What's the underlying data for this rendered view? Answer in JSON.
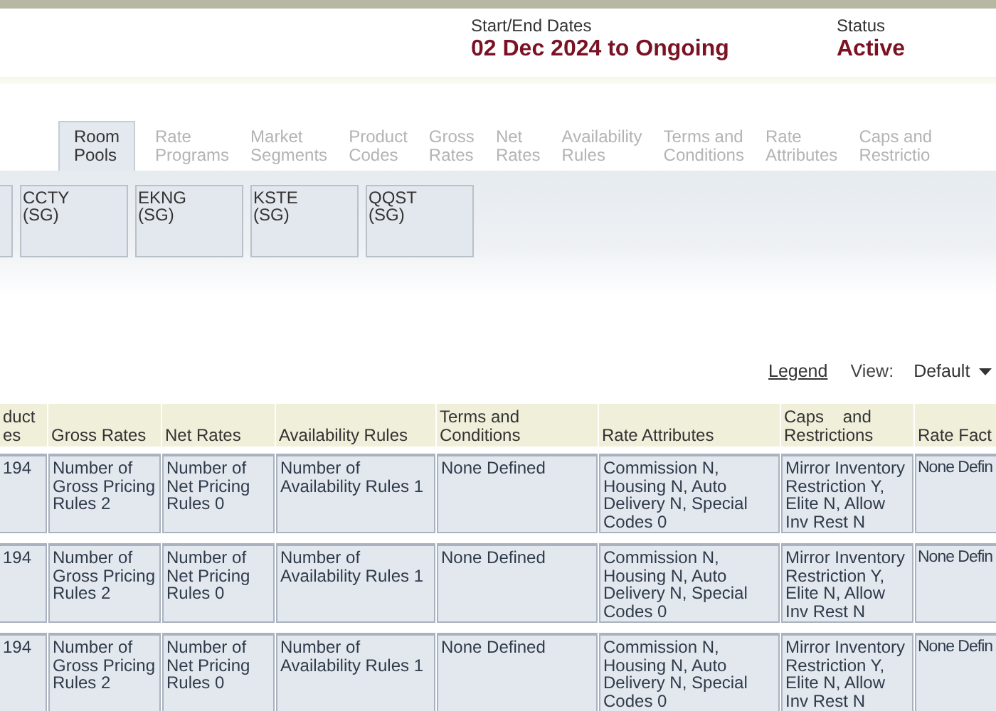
{
  "header": {
    "dates_label": "Start/End Dates",
    "dates_value": "02 Dec 2024 to Ongoing",
    "status_label": "Status",
    "status_value": "Active"
  },
  "tabs": [
    {
      "label": "Room\nPools",
      "selected": true
    },
    {
      "label": "Rate\nPrograms",
      "selected": false
    },
    {
      "label": "Market\nSegments",
      "selected": false
    },
    {
      "label": "Product\nCodes",
      "selected": false
    },
    {
      "label": "Gross\nRates",
      "selected": false
    },
    {
      "label": "Net\nRates",
      "selected": false
    },
    {
      "label": "Availability\nRules",
      "selected": false
    },
    {
      "label": "Terms and\nConditions",
      "selected": false
    },
    {
      "label": "Rate\nAttributes",
      "selected": false
    },
    {
      "label": "Caps and\nRestrictio",
      "selected": false
    }
  ],
  "room_pools": [
    {
      "code": "CCTY",
      "group": "(SG)"
    },
    {
      "code": "EKNG",
      "group": "(SG)"
    },
    {
      "code": "KSTE",
      "group": "(SG)"
    },
    {
      "code": "QQST",
      "group": "(SG)"
    }
  ],
  "view_bar": {
    "legend": "Legend",
    "view_label": "View:",
    "view_value": "Default"
  },
  "table": {
    "columns": [
      "duct\nes",
      "Gross Rates",
      "Net Rates",
      "Availability Rules",
      "Terms and\nConditions",
      "Rate Attributes",
      "Caps    and\nRestrictions",
      "Rate Fact"
    ],
    "rows": [
      [
        "194",
        "Number of Gross Pricing Rules 2",
        "Number of Net Pricing Rules 0",
        "Number of Availability Rules 1",
        "None Defined",
        "Commission N, Housing N, Auto Delivery N, Special Codes 0",
        "Mirror Inventory Restriction Y, Elite N, Allow Inv Rest N",
        "None Defin"
      ],
      [
        "194",
        "Number of Gross Pricing Rules 2",
        "Number of Net Pricing Rules 0",
        "Number of Availability Rules 1",
        "None Defined",
        "Commission N, Housing N, Auto Delivery N, Special Codes 0",
        "Mirror Inventory Restriction Y, Elite N, Allow Inv Rest N",
        "None Defin"
      ],
      [
        "194",
        "Number of Gross Pricing Rules 2",
        "Number of Net Pricing Rules 0",
        "Number of Availability Rules 1",
        "None Defined",
        "Commission N, Housing N, Auto Delivery N, Special Codes 0",
        "Mirror Inventory Restriction Y, Elite N, Allow Inv Rest N",
        "None Defin"
      ]
    ]
  }
}
